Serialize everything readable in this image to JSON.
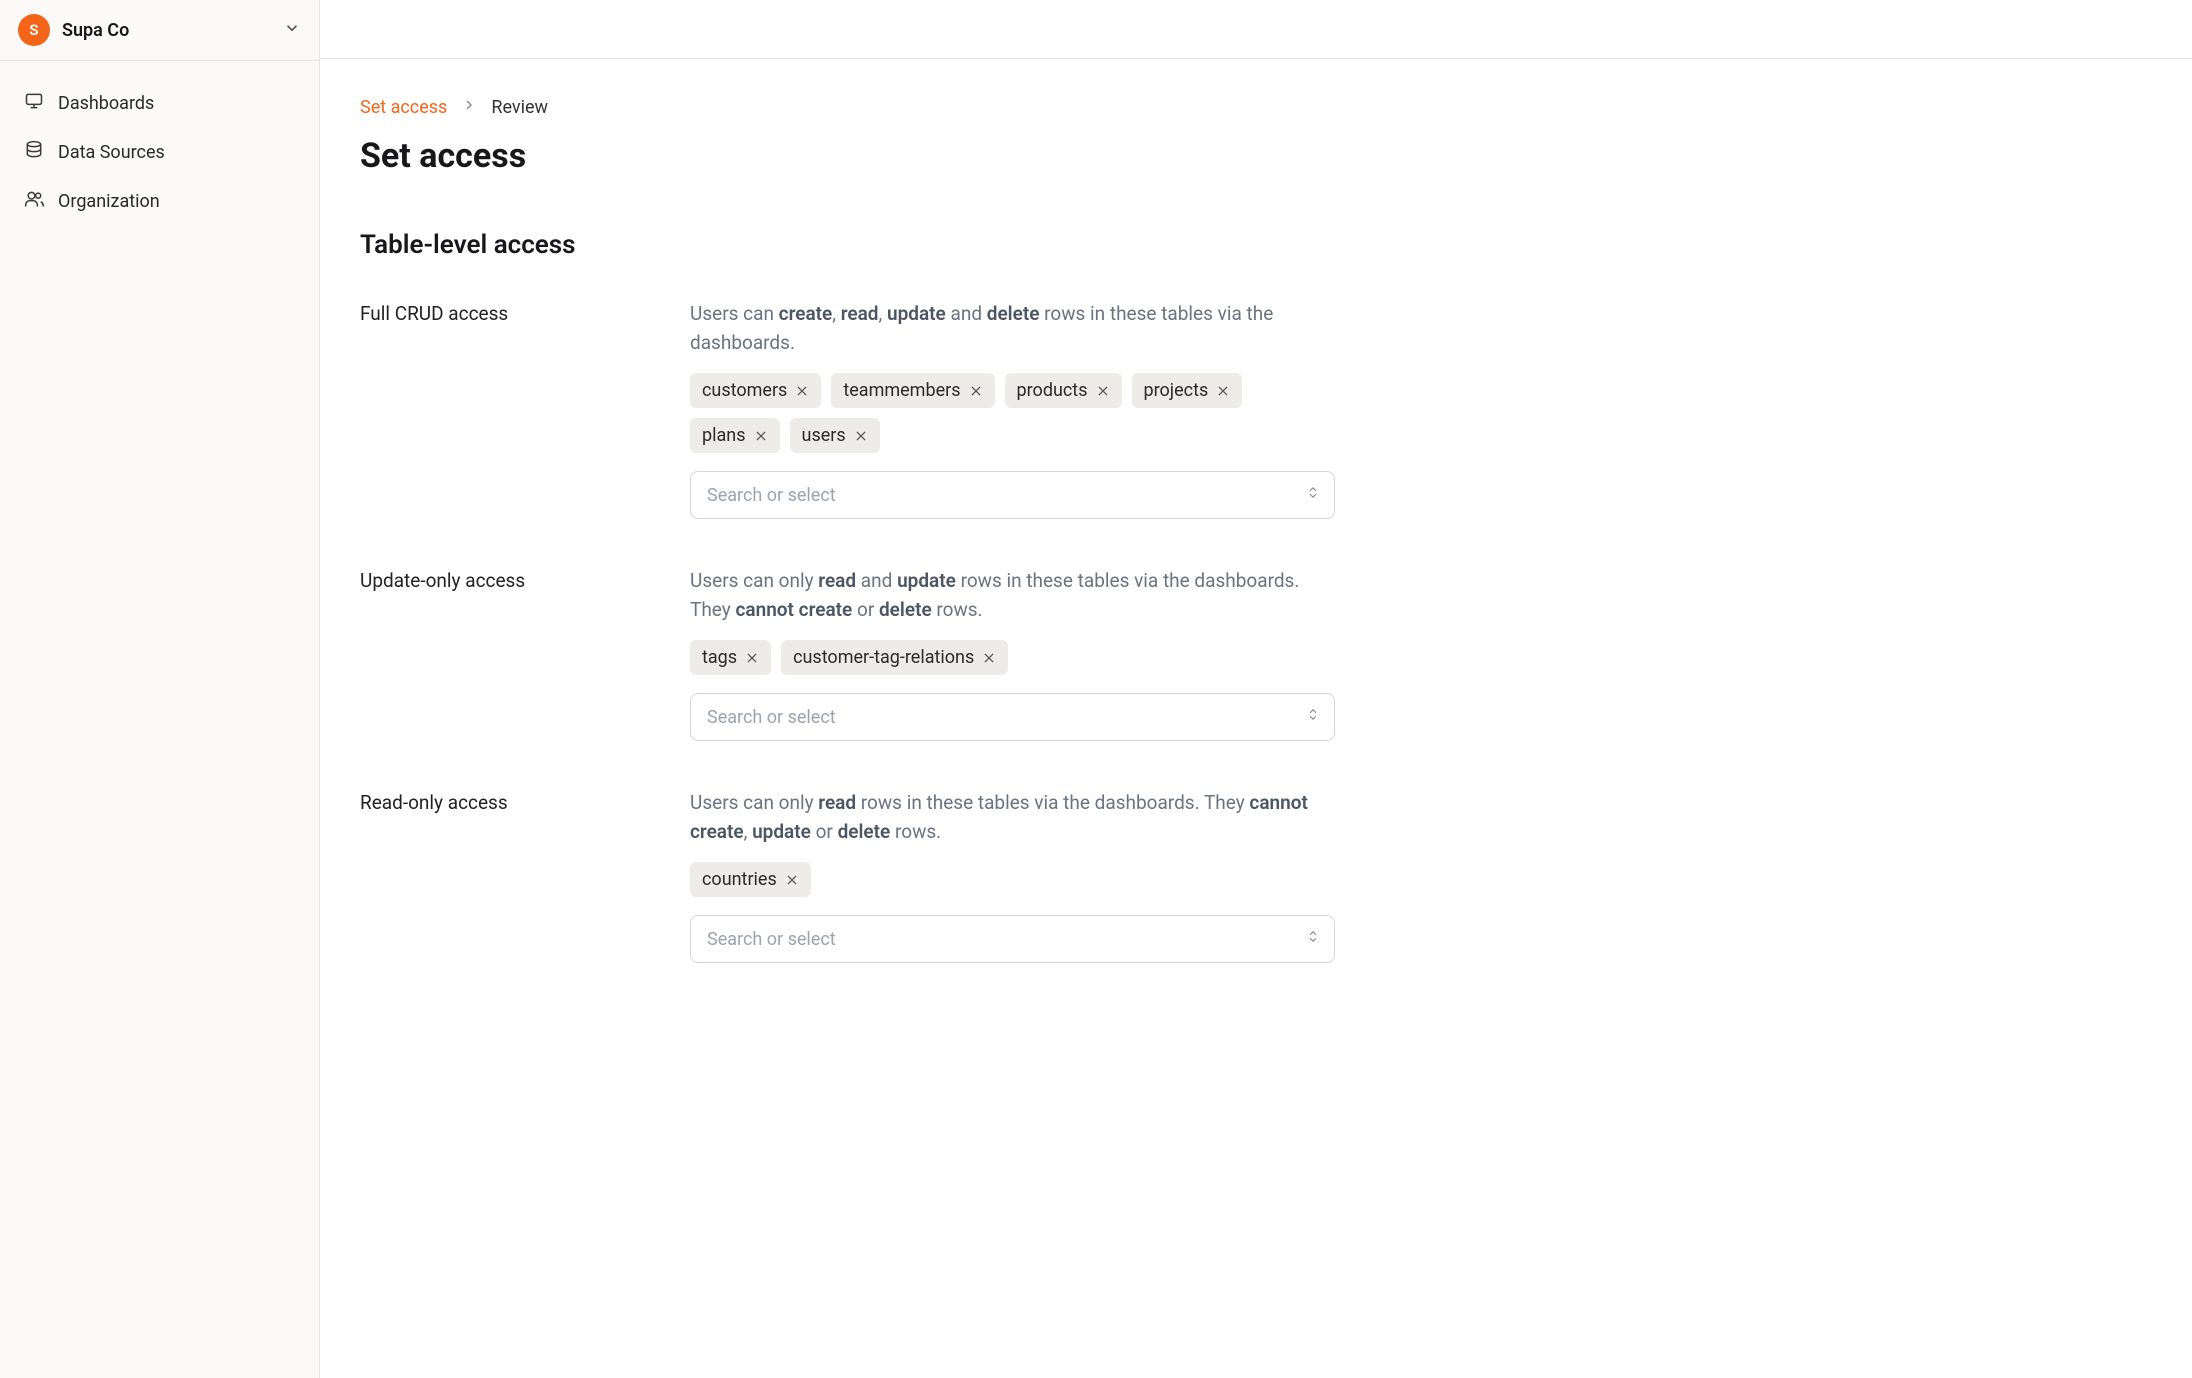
{
  "org": {
    "avatar_initial": "S",
    "name": "Supa Co"
  },
  "sidebar": {
    "items": [
      {
        "id": "dashboards",
        "label": "Dashboards",
        "icon": "monitor-icon"
      },
      {
        "id": "datasources",
        "label": "Data Sources",
        "icon": "database-icon"
      },
      {
        "id": "organization",
        "label": "Organization",
        "icon": "users-icon"
      }
    ]
  },
  "breadcrumb": {
    "current": "Set access",
    "next": "Review"
  },
  "page_title": "Set access",
  "section_title": "Table-level access",
  "select_placeholder": "Search or select",
  "access": {
    "full": {
      "label": "Full CRUD access",
      "desc_parts": [
        "Users can ",
        "create",
        ", ",
        "read",
        ", ",
        "update",
        " and ",
        "delete",
        " rows in these tables via the dashboards."
      ],
      "chips": [
        "customers",
        "teammembers",
        "products",
        "projects",
        "plans",
        "users"
      ]
    },
    "update": {
      "label": "Update-only access",
      "desc_parts": [
        "Users can only ",
        "read",
        " and ",
        "update",
        " rows in these tables via the dashboards. They ",
        "cannot create",
        " or ",
        "delete",
        " rows."
      ],
      "chips": [
        "tags",
        "customer-tag-relations"
      ]
    },
    "read": {
      "label": "Read-only access",
      "desc_parts": [
        "Users can only ",
        "read",
        " rows in these tables via the dashboards. They ",
        "cannot create",
        ", ",
        "update",
        " or ",
        "delete",
        " rows."
      ],
      "chips": [
        "countries"
      ]
    }
  }
}
